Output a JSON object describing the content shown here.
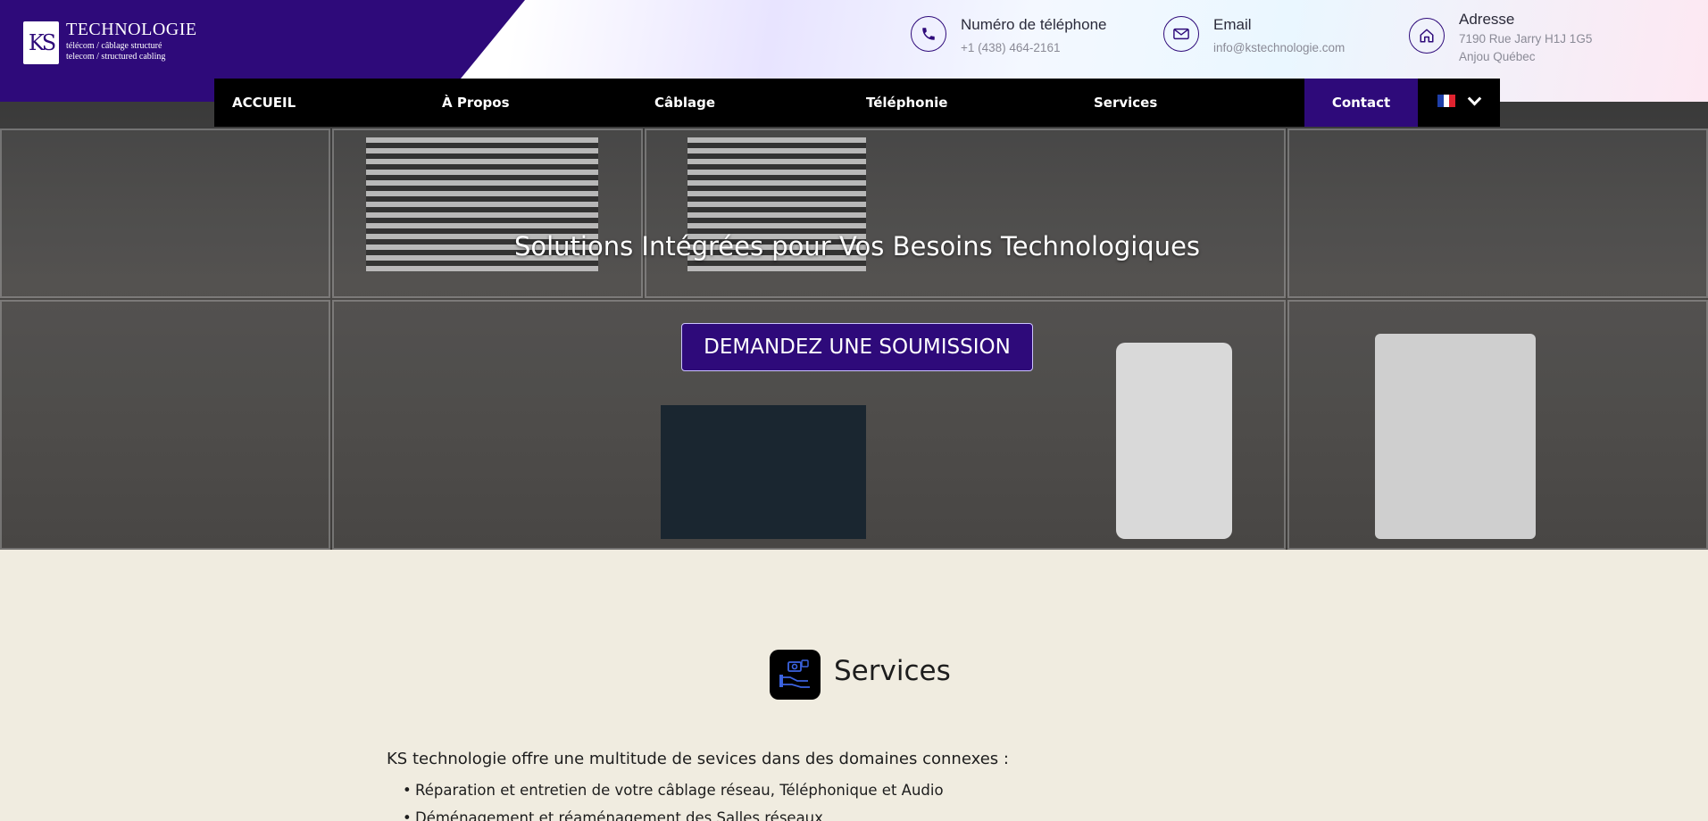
{
  "brand": {
    "logo_letters": "KS",
    "name": "TECHNOLOGIE",
    "tagline_fr": "télécom / câblage structuré",
    "tagline_en": "telecom / structured cabling",
    "color": "#2e0a7a"
  },
  "contacts": [
    {
      "icon": "phone-icon",
      "label": "Numéro de téléphone",
      "value": "+1 (438) 464-2161"
    },
    {
      "icon": "mail-icon",
      "label": "Email",
      "value": "info@kstechnologie.com"
    },
    {
      "icon": "home-icon",
      "label": "Adresse",
      "value": "7190 Rue Jarry H1J 1G5",
      "value2": "Anjou Québec"
    }
  ],
  "nav": {
    "items": [
      "ACCUEIL",
      "À Propos",
      "Câblage",
      "Téléphonie",
      "Services"
    ],
    "contact": "Contact",
    "language": "fr"
  },
  "hero": {
    "title": "Solutions Intégrées pour Vos Besoins Technologiques",
    "button": "DEMANDEZ UNE SOUMISSION"
  },
  "services": {
    "icon": "services-icon",
    "title": "Services",
    "intro": "KS technologie offre une multitude de sevices dans des domaines connexes :",
    "items": [
      "Réparation et entretien de votre câblage réseau, Téléphonique et Audio",
      "Déménagement et réaménagement des Salles réseaux"
    ]
  }
}
